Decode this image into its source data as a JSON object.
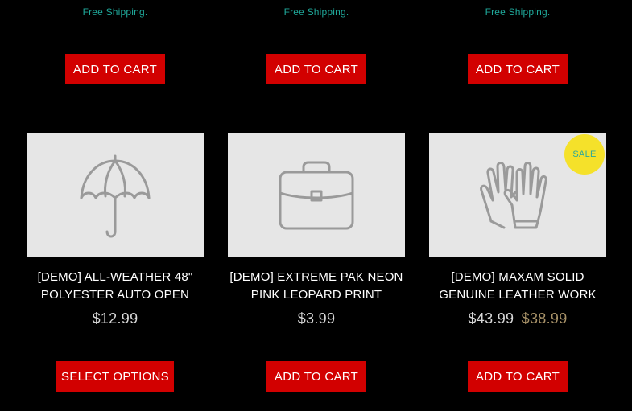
{
  "top_row": [
    {
      "shipping": "Free Shipping.",
      "button": "ADD TO CART"
    },
    {
      "shipping": "Free Shipping.",
      "button": "ADD TO CART"
    },
    {
      "shipping": "Free Shipping.",
      "button": "ADD TO CART"
    }
  ],
  "products": [
    {
      "icon": "umbrella-icon",
      "title_line1": "[DEMO] ALL-WEATHER 48\"",
      "title_line2": "POLYESTER AUTO OPEN",
      "price": "$12.99",
      "button": "SELECT OPTIONS"
    },
    {
      "icon": "briefcase-icon",
      "title_line1": "[DEMO] EXTREME PAK NEON",
      "title_line2": "PINK LEOPARD PRINT",
      "price": "$3.99",
      "button": "ADD TO CART"
    },
    {
      "icon": "gloves-icon",
      "badge": "SALE",
      "title_line1": "[DEMO] MAXAM SOLID",
      "title_line2": "GENUINE LEATHER WORK",
      "price_old": "$43.99",
      "price_new": "$38.99",
      "button": "ADD TO CART"
    }
  ],
  "colors": {
    "background": "#000000",
    "button": "#d20000",
    "shipping_text": "#1fa89a",
    "sale_badge": "#f5e12a",
    "sale_price": "#a89268",
    "thumb_bg": "#e6e6e6",
    "icon_stroke": "#9a9a9a"
  }
}
